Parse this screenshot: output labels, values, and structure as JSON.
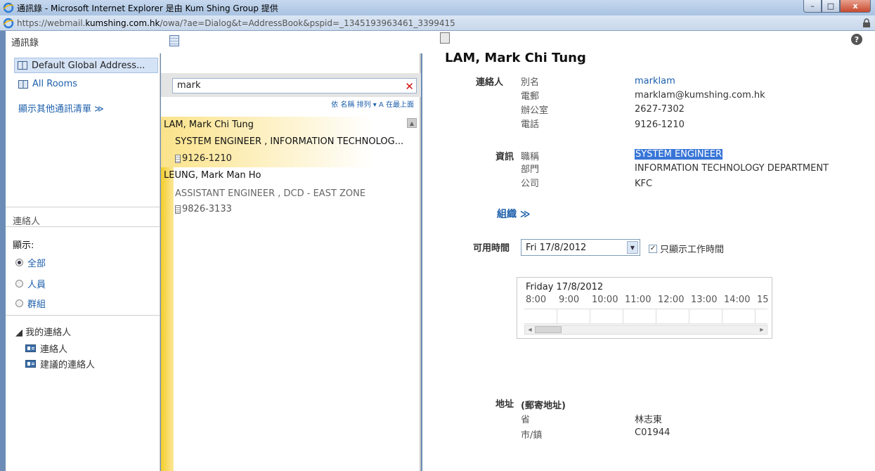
{
  "window": {
    "title": "通訊錄 - Microsoft Internet Explorer 是由 Kum Shing Group 提供",
    "url_prefix": "https://webmail.",
    "url_domain": "kumshing.com.hk",
    "url_rest": "/owa/?ae=Dialog&t=AddressBook&pspid=_1345193963461_3399415",
    "min_glyph": "–",
    "max_glyph": "□",
    "close_glyph": "x"
  },
  "left": {
    "header": "通訊錄",
    "items": [
      {
        "label": "Default Global Address..."
      },
      {
        "label": "All Rooms"
      }
    ],
    "more_lists": "顯示其他通訊清單 ≫",
    "contacts_title": "連絡人",
    "show_label": "顯示:",
    "filters": [
      {
        "label": "全部",
        "selected": true
      },
      {
        "label": "人員",
        "selected": false
      },
      {
        "label": "群組",
        "selected": false
      }
    ],
    "my_contacts": "◢ 我的連絡人",
    "folders": [
      {
        "label": "連絡人"
      },
      {
        "label": "建議的連絡人"
      }
    ]
  },
  "middle": {
    "search_value": "mark",
    "clear_glyph": "✕",
    "sort_text": "依 名稱 排列 ▾   A 在最上面",
    "results": [
      {
        "name": "LAM, Mark Chi Tung",
        "title": "SYSTEM ENGINEER , INFORMATION TECHNOLOG...",
        "phone": "9126-1210",
        "selected": true
      },
      {
        "name": "LEUNG, Mark Man Ho",
        "title": "ASSISTANT ENGINEER , DCD - EAST ZONE",
        "phone": "9826-3133",
        "selected": false
      }
    ]
  },
  "detail": {
    "help_glyph": "?",
    "name": "LAM, Mark Chi Tung",
    "contact_section": "連絡人",
    "contact_fields": [
      {
        "label": "別名",
        "value": "marklam"
      },
      {
        "label": "電郵",
        "value": "marklam@kumshing.com.hk"
      },
      {
        "label": "辦公室",
        "value": "2627-7302"
      },
      {
        "label": "電話",
        "value": "9126-1210"
      }
    ],
    "info_section": "資訊",
    "info_fields": [
      {
        "label": "職稱",
        "value": "SYSTEM ENGINEER"
      },
      {
        "label": "部門",
        "value": "INFORMATION TECHNOLOGY DEPARTMENT"
      },
      {
        "label": "公司",
        "value": "KFC"
      }
    ],
    "org_link": "組織 ≫",
    "avail_label": "可用時間",
    "date_value": "Fri 17/8/2012",
    "work_hours_label": "只顯示工作時間",
    "schedule_title": "Friday 17/8/2012",
    "hours": [
      "8:00",
      "9:00",
      "10:00",
      "11:00",
      "12:00",
      "13:00",
      "14:00",
      "15"
    ],
    "address_section": "地址",
    "address_sub": "(郵寄地址)",
    "address_fields": [
      {
        "label": "省",
        "value": "林志東"
      },
      {
        "label": "市/鎮",
        "value": "C01944"
      }
    ]
  }
}
